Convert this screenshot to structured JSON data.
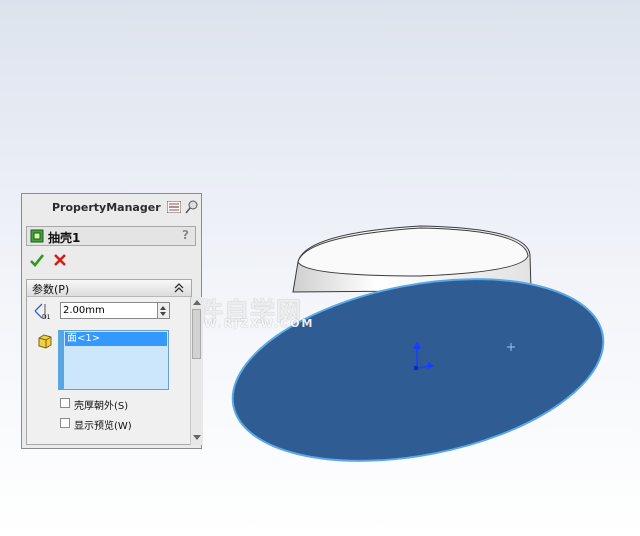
{
  "panel": {
    "title": "PropertyManager",
    "feature_name": "抽壳1",
    "help_label": "?",
    "group_title": "参数(P)",
    "thickness_value": "2.00mm",
    "faces": [
      "面<1>"
    ],
    "options": [
      {
        "label": "壳厚朝外(S)",
        "checked": false
      },
      {
        "label": "显示预览(W)",
        "checked": false
      }
    ]
  },
  "watermark": {
    "main": "软件自学网",
    "sub": "WWW.RJZXW.COM"
  },
  "colors": {
    "face_fill": "#2f5c93",
    "face_edge": "#5aa8e6",
    "selection": "#3399ff",
    "ok": "#2e9a1a",
    "cancel": "#d11f1f"
  }
}
